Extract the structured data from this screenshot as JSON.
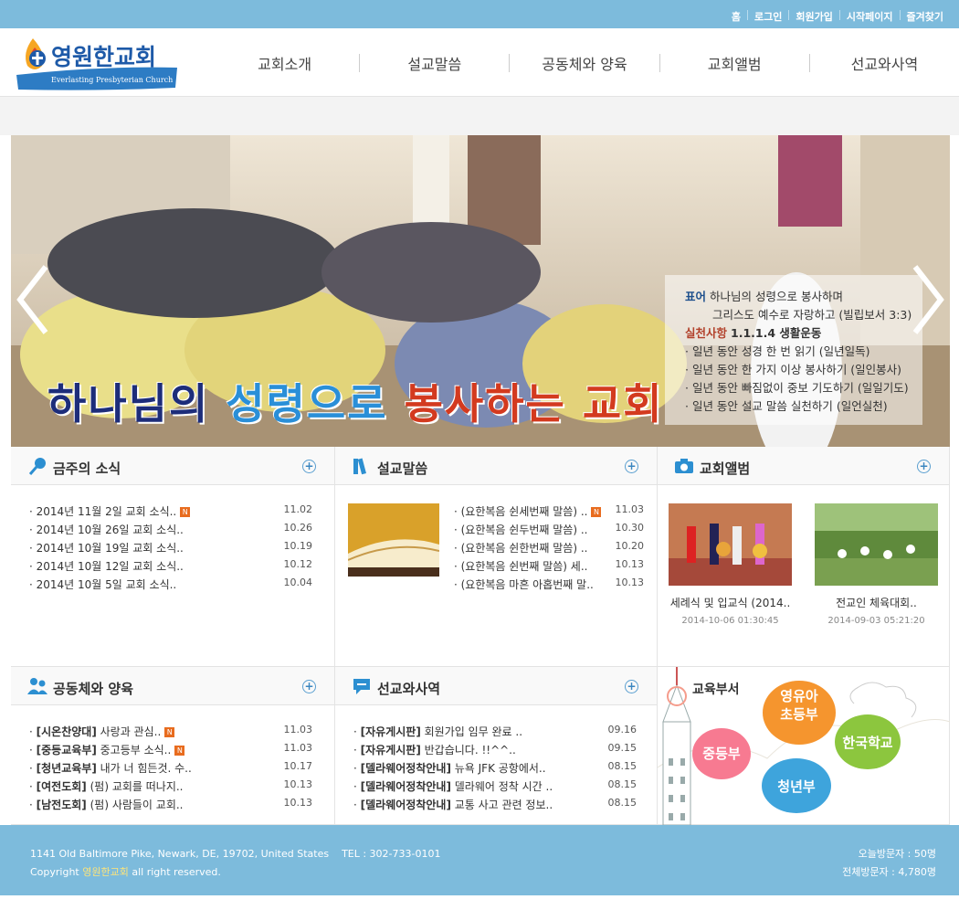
{
  "toplinks": [
    "홈",
    "로그인",
    "회원가입",
    "시작페이지",
    "즐겨찾기"
  ],
  "logo": {
    "text": "영원한교회",
    "sub": "Everlasting Presbyterian Church"
  },
  "nav": [
    "교회소개",
    "설교말씀",
    "공동체와 양육",
    "교회앨범",
    "선교와사역"
  ],
  "banner": {
    "slogan_parts": [
      "하나님의 ",
      "성령으로 ",
      "봉사하는 교회"
    ],
    "motto_label": "표어",
    "motto_line1": "하나님의 성령으로 봉사하며",
    "motto_line2": "그리스도 예수로 자랑하고 (빌립보서 3:3)",
    "practice_label": "실천사항",
    "practice_title": "1.1.1.4 생활운동",
    "practices": [
      "· 일년 동안 성경 한 번 읽기 (일년일독)",
      "· 일년 동안 한 가지 이상 봉사하기 (일인봉사)",
      "· 일년 동안 빠짐없이 중보 기도하기 (일일기도)",
      "· 일년 동안 설교 말씀 실천하기 (일언실천)"
    ]
  },
  "news": {
    "title": "금주의 소식",
    "items": [
      {
        "text": "· 2014년 11월 2일 교회 소식..",
        "date": "11.02",
        "new": true
      },
      {
        "text": "· 2014년 10월 26일 교회 소식..",
        "date": "10.26",
        "new": false
      },
      {
        "text": "· 2014년 10월 19일 교회 소식..",
        "date": "10.19",
        "new": false
      },
      {
        "text": "· 2014년 10월 12일 교회 소식..",
        "date": "10.12",
        "new": false
      },
      {
        "text": "· 2014년 10월 5일 교회 소식..",
        "date": "10.04",
        "new": false
      }
    ]
  },
  "sermon": {
    "title": "설교말씀",
    "items": [
      {
        "text": "· (요한복음 쉰세번째 말씀) ..",
        "date": "11.03",
        "new": true
      },
      {
        "text": "· (요한복음 쉰두번째 말씀) ..",
        "date": "10.30",
        "new": false
      },
      {
        "text": "· (요한복음 쉰한번째 말씀) ..",
        "date": "10.20",
        "new": false
      },
      {
        "text": "· (요한복음 쉰번째 말씀) 세..",
        "date": "10.13",
        "new": false
      },
      {
        "text": "· (요한복음 마흔 아홉번째 말..",
        "date": "10.13",
        "new": false
      }
    ]
  },
  "album": {
    "title": "교회앨범",
    "items": [
      {
        "caption": "세례식 및 입교식 (2014..",
        "date": "2014-10-06 01:30:45"
      },
      {
        "caption": "전교인 체육대회..",
        "date": "2014-09-03 05:21:20"
      }
    ]
  },
  "community": {
    "title": "공동체와 양육",
    "items": [
      {
        "tag": "[시온찬양대]",
        "text": " 사랑과 관심..",
        "date": "11.03",
        "new": true
      },
      {
        "tag": "[중등교육부]",
        "text": " 중고등부 소식..",
        "date": "11.03",
        "new": true
      },
      {
        "tag": "[청년교육부]",
        "text": " 내가 너 힘든것. 수..",
        "date": "10.17",
        "new": false
      },
      {
        "tag": "[여전도회]",
        "text": " (펌) 교회를 떠나지..",
        "date": "10.13",
        "new": false
      },
      {
        "tag": "[남전도회]",
        "text": " (펌) 사람들이 교회..",
        "date": "10.13",
        "new": false
      }
    ]
  },
  "mission": {
    "title": "선교와사역",
    "items": [
      {
        "tag": "[자유게시판]",
        "text": " 회원가입 임무 완료 ..",
        "date": "09.16"
      },
      {
        "tag": "[자유게시판]",
        "text": " 반갑습니다. !!^^..",
        "date": "09.15"
      },
      {
        "tag": "[델라웨어정착안내]",
        "text": " 뉴욕 JFK 공항에서..",
        "date": "08.15"
      },
      {
        "tag": "[델라웨어정착안내]",
        "text": " 델라웨어 정착 시간 ..",
        "date": "08.15"
      },
      {
        "tag": "[델라웨어정착안내]",
        "text": " 교통 사고 관련 정보..",
        "date": "08.15"
      }
    ]
  },
  "education": {
    "title": "교육부서",
    "bubbles": [
      "영유아\n초등부",
      "중등부",
      "한국학교",
      "청년부"
    ]
  },
  "footer": {
    "address": "1141 Old Baltimore Pike, Newark, DE, 19702, United States    TEL : 302-733-0101",
    "copyright_pre": "Copyright ",
    "copyright_brand": "영원한교회",
    "copyright_post": " all right reserved.",
    "today": "오늘방문자 : 50명",
    "total": "전체방문자 : 4,780명"
  },
  "colors": {
    "topbar": "#7dbbdc",
    "accent_blue": "#1d4f8c",
    "accent_red": "#b2402a",
    "new_badge": "#e86c1f"
  }
}
